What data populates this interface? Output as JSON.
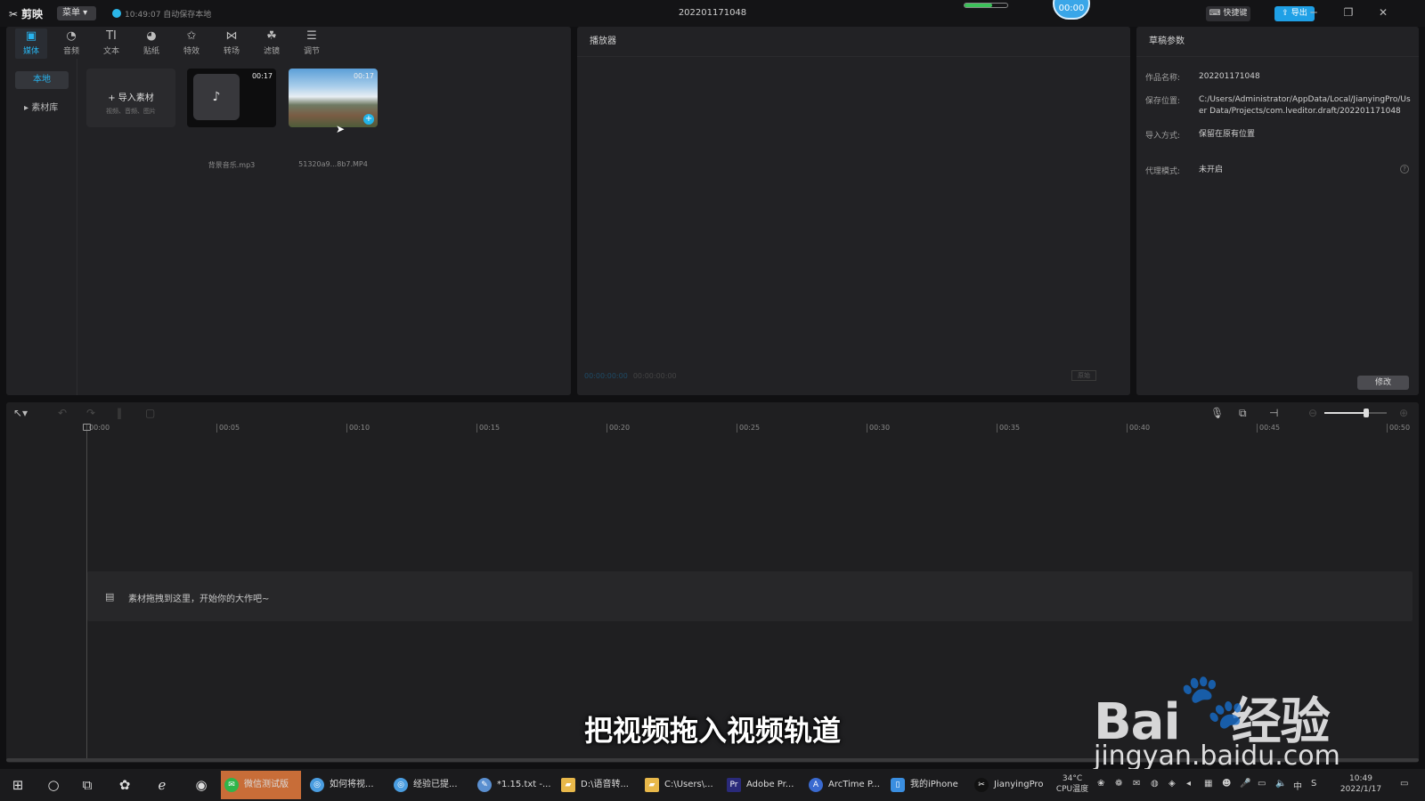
{
  "titlebar": {
    "app_name": "剪映",
    "menu_label": "菜单",
    "autosave_text": "10:49:07 自动保存本地",
    "project_title": "202201171048",
    "timer_bubble": "00:00",
    "shortcut_label": "快捷键",
    "export_label": "导出",
    "colors": {
      "accent": "#1fa0e6"
    }
  },
  "toolbar": {
    "items": [
      {
        "icon": "media-icon",
        "label": "媒体"
      },
      {
        "icon": "audio-icon",
        "label": "音频"
      },
      {
        "icon": "text-icon",
        "label": "文本"
      },
      {
        "icon": "sticker-icon",
        "label": "贴纸"
      },
      {
        "icon": "effects-icon",
        "label": "特效"
      },
      {
        "icon": "transition-icon",
        "label": "转场"
      },
      {
        "icon": "filter-icon",
        "label": "滤镜"
      },
      {
        "icon": "adjust-icon",
        "label": "调节"
      }
    ]
  },
  "media": {
    "sidebar": {
      "local": "本地",
      "library": "素材库"
    },
    "import": {
      "title": "导入素材",
      "subtitle": "视频、音频、图片"
    },
    "items": [
      {
        "name": "背景音乐.mp3",
        "duration": "00:17",
        "type": "audio"
      },
      {
        "name": "51320a9...8b7.MP4",
        "duration": "00:17",
        "type": "video"
      }
    ]
  },
  "player": {
    "title": "播放器",
    "current_time": "00:00:00:00",
    "total_time": "00:00:00:00",
    "ratio_label": "原始"
  },
  "draft": {
    "title": "草稿参数",
    "name_label": "作品名称:",
    "name_value": "202201171048",
    "path_label": "保存位置:",
    "path_value": "C:/Users/Administrator/AppData/Local/JianyingPro/User Data/Projects/com.lveditor.draft/202201171048",
    "import_label": "导入方式:",
    "import_value": "保留在原有位置",
    "proxy_label": "代理模式:",
    "proxy_value": "未开启",
    "modify_label": "修改"
  },
  "timeline": {
    "ticks": [
      "00:00",
      "00:05",
      "00:10",
      "00:15",
      "00:20",
      "00:25",
      "00:30",
      "00:35",
      "00:40",
      "00:45",
      "00:50"
    ],
    "drop_hint": "素材拖拽到这里，开始你的大作吧~",
    "zoom_level": 0.66
  },
  "overlay": {
    "subtitle": "把视频拖入视频轨道",
    "watermark_brand": "Bai",
    "watermark_brand2": "经验",
    "watermark_url": "jingyan.baidu.com"
  },
  "taskbar": {
    "apps": [
      {
        "label": "微信测试版",
        "icon_color": "#2fb54a"
      },
      {
        "label": "如何将视...",
        "icon_color": "#4a9de0"
      },
      {
        "label": "经验已提...",
        "icon_color": "#4a9de0"
      },
      {
        "label": "*1.15.txt -...",
        "icon_color": "#5a8fd0"
      },
      {
        "label": "D:\\语音转...",
        "icon_color": "#e8b84a"
      },
      {
        "label": "C:\\Users\\...",
        "icon_color": "#e8b84a"
      },
      {
        "label": "Adobe Pr...",
        "icon_color": "#2a2a7a"
      },
      {
        "label": "ArcTime P...",
        "icon_color": "#3a6ad0"
      },
      {
        "label": "我的iPhone",
        "icon_color": "#3a8ee0"
      },
      {
        "label": "JianyingPro",
        "icon_color": "#111111"
      }
    ],
    "temp": "34°C",
    "cpu_label": "CPU温度",
    "ime": "中",
    "clock_time": "10:49",
    "clock_date": "2022/1/17"
  }
}
